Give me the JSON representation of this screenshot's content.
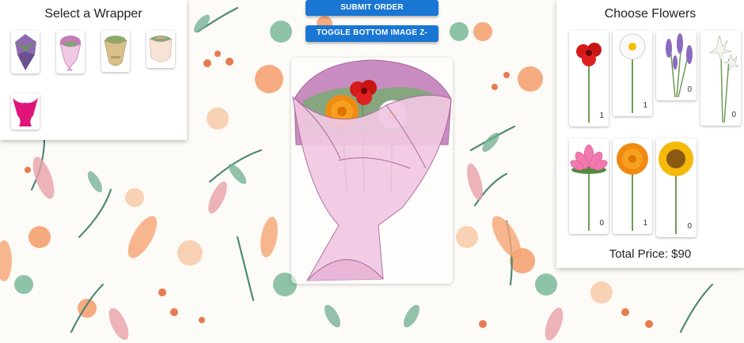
{
  "wrapper_panel": {
    "title": "Select a Wrapper",
    "items": [
      {
        "name": "purple-green wrapper",
        "color": "#7e5aa0"
      },
      {
        "name": "pink wrapper",
        "color": "#d98fc4"
      },
      {
        "name": "kraft wrapper",
        "color": "#d9c08a"
      },
      {
        "name": "cream wrapper",
        "color": "#f2d6c6"
      },
      {
        "name": "magenta wrapper",
        "color": "#e0157a"
      }
    ]
  },
  "actions": {
    "submit_label": "SUBMIT ORDER",
    "toggle_label": "TOGGLE BOTTOM IMAGE Z-INDEX"
  },
  "flower_panel": {
    "title": "Choose Flowers",
    "flowers": [
      {
        "name": "red amaryllis",
        "count": "1"
      },
      {
        "name": "white daisy",
        "count": "1"
      },
      {
        "name": "lavender",
        "count": "0"
      },
      {
        "name": "white lily",
        "count": "0"
      },
      {
        "name": "pink water lily",
        "count": "0"
      },
      {
        "name": "orange marigold",
        "count": "1"
      },
      {
        "name": "sunflower",
        "count": "0"
      }
    ],
    "total_price": "Total Price: $90"
  },
  "colors": {
    "accent": "#1976d2",
    "wrap_pink": "#f0c8e2",
    "wrap_mauve": "#c27db2",
    "leaf_green": "#7da878"
  }
}
